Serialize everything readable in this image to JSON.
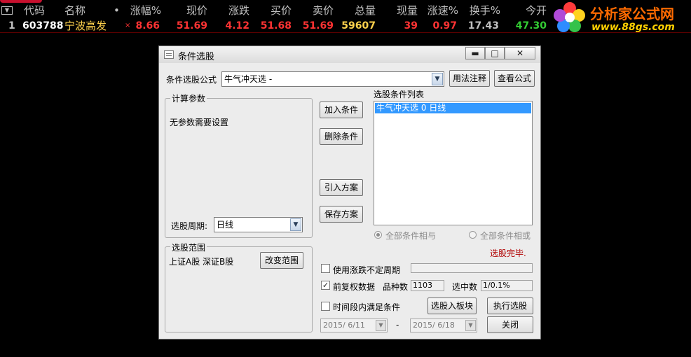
{
  "stock_table": {
    "columns": [
      "代码",
      "名称",
      "•",
      "涨幅%",
      "现价",
      "涨跌",
      "买价",
      "卖价",
      "总量",
      "现量",
      "涨速%",
      "换手%",
      "今开"
    ],
    "rows": [
      {
        "index": "1",
        "code": "603788",
        "name": "宁波高发",
        "mark": "×",
        "change_pct": "8.66",
        "price": "51.69",
        "change": "4.12",
        "bid": "51.68",
        "ask": "51.69",
        "volume": "59607",
        "last_vol": "39",
        "speed": "0.97",
        "turnover": "17.43",
        "open": "47.30"
      }
    ]
  },
  "logo": {
    "title": "分析家公式网",
    "url": "www.88gs.com"
  },
  "dialog": {
    "title": "条件选股",
    "window_buttons": {
      "minimize": "▬",
      "maximize": "□",
      "close": "✕"
    },
    "formula_label": "条件选股公式",
    "formula_value": "牛气冲天选 -",
    "usage_button": "用法注释",
    "view_formula_button": "查看公式",
    "params_group": "计算参数",
    "no_params_text": "无参数需要设置",
    "period_label": "选股周期:",
    "period_value": "日线",
    "range_group": "选股范围",
    "range_value": "上证A股 深证B股",
    "change_range_button": "改变范围",
    "add_condition_button": "加入条件",
    "delete_condition_button": "删除条件",
    "import_plan_button": "引入方案",
    "save_plan_button": "保存方案",
    "condition_list_label": "选股条件列表",
    "condition_items": [
      "牛气冲天选  0 日线"
    ],
    "radio_all_and": "全部条件相与",
    "radio_all_or": "全部条件相或",
    "status_text": "选股完毕.",
    "uncertain_period_label": "使用涨跌不定周期",
    "uncertain_period_checked": false,
    "adjusted_data_label": "前复权数据",
    "adjusted_data_checked": true,
    "variety_count_label": "品种数",
    "variety_count_value": "1103",
    "selected_count_label": "选中数",
    "selected_count_value": "1/0.1%",
    "time_range_label": "时间段内满足条件",
    "time_range_checked": false,
    "to_block_button": "选股入板块",
    "execute_button": "执行选股",
    "date_from": "2015/ 6/11",
    "date_sep": "-",
    "date_to": "2015/ 6/18",
    "close_button": "关闭"
  },
  "colors": {
    "up": "#ff3333",
    "volume": "#ffd24d",
    "code": "#ffffff",
    "neutral": "#c0c0c0",
    "open": "#33cc33",
    "status": "#b00000",
    "selection": "#3399ff"
  },
  "icons": [
    "sort-toggle-icon",
    "app-doc-icon",
    "minimize-icon",
    "maximize-icon",
    "close-icon",
    "dropdown-arrow-icon",
    "checkbox-check-icon",
    "logo-flower-icon"
  ]
}
